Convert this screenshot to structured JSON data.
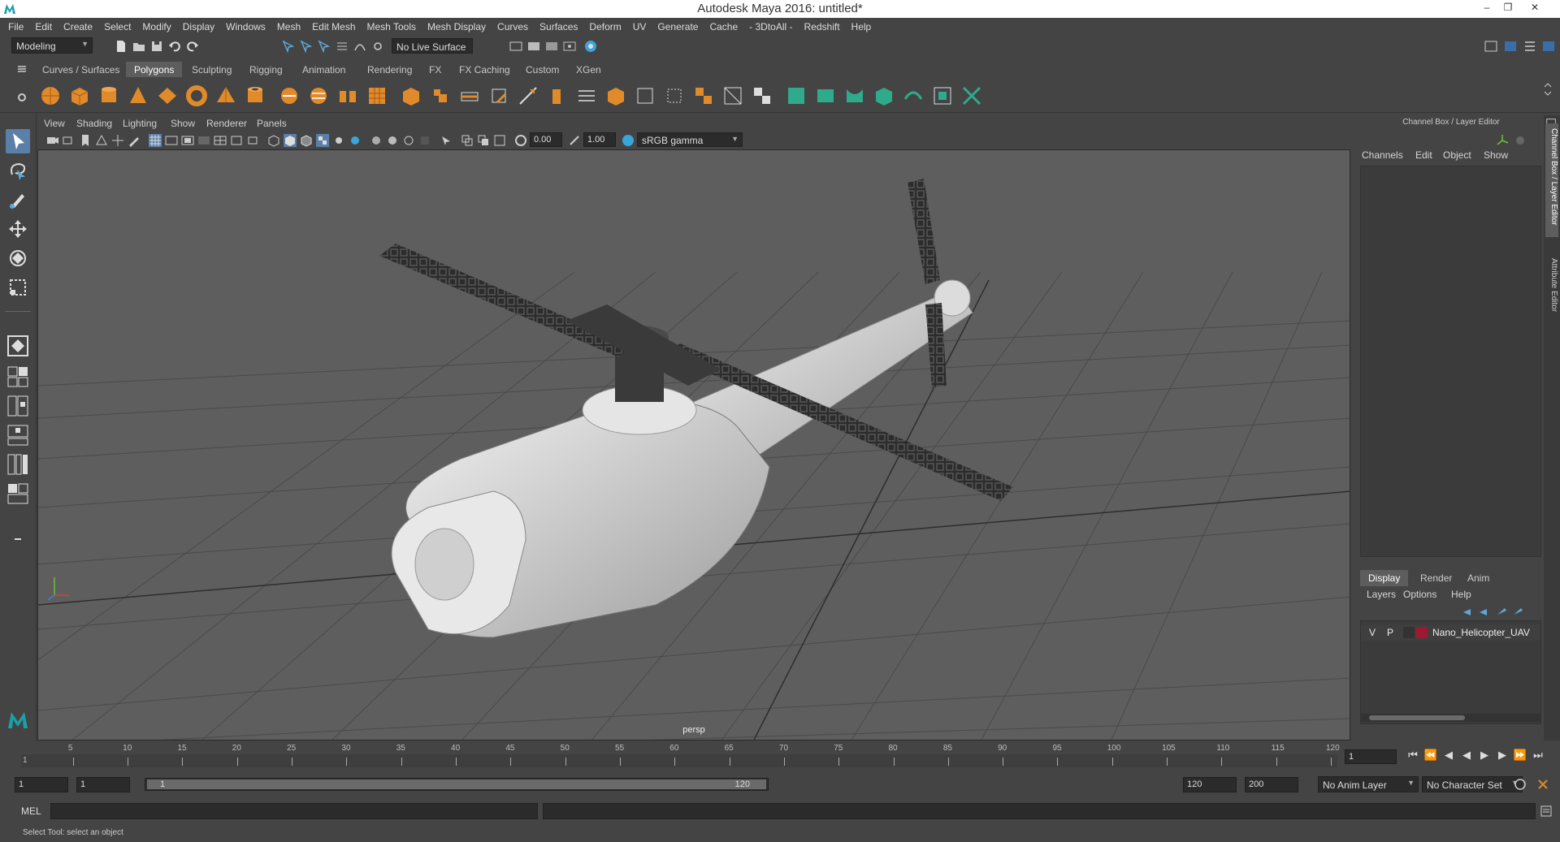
{
  "window": {
    "title": "Autodesk Maya 2016: untitled*",
    "minimize": "–",
    "restore": "❐",
    "close": "✕"
  },
  "menubar": [
    "File",
    "Edit",
    "Create",
    "Select",
    "Modify",
    "Display",
    "Windows",
    "Mesh",
    "Edit Mesh",
    "Mesh Tools",
    "Mesh Display",
    "Curves",
    "Surfaces",
    "Deform",
    "UV",
    "Generate",
    "Cache",
    "- 3DtoAll -",
    "Redshift",
    "Help"
  ],
  "statusline": {
    "menuset": "Modeling",
    "live_surface": "No Live Surface"
  },
  "shelf": {
    "tabs": [
      "Curves / Surfaces",
      "Polygons",
      "Sculpting",
      "Rigging",
      "Animation",
      "Rendering",
      "FX",
      "FX Caching",
      "Custom",
      "XGen"
    ],
    "active_tab": "Polygons"
  },
  "viewport": {
    "menus": [
      "View",
      "Shading",
      "Lighting",
      "Show",
      "Renderer",
      "Panels"
    ],
    "exposure": "0.00",
    "gamma": "1.00",
    "color_space": "sRGB gamma",
    "camera": "persp"
  },
  "channelbox": {
    "header": "Channel Box / Layer Editor",
    "menus": [
      "Channels",
      "Edit",
      "Object",
      "Show"
    ],
    "layer_tabs": [
      "Display",
      "Render",
      "Anim"
    ],
    "active_layer_tab": "Display",
    "layer_menus": [
      "Layers",
      "Options",
      "Help"
    ],
    "layer": {
      "visible": "V",
      "playback": "P",
      "name": "Nano_Helicopter_UAV",
      "color": "#a0182f"
    }
  },
  "side_tabs": [
    "Channel Box / Layer Editor",
    "Attribute Editor"
  ],
  "timeline": {
    "ticks": [
      "5",
      "10",
      "15",
      "20",
      "25",
      "30",
      "35",
      "40",
      "45",
      "50",
      "55",
      "60",
      "65",
      "70",
      "75",
      "80",
      "85",
      "90",
      "95",
      "100",
      "105",
      "110",
      "115",
      "120"
    ],
    "start_marker": "1",
    "current_frame": "1"
  },
  "range": {
    "start_frame": "1",
    "playback_start": "1",
    "range_start_label": "1",
    "range_end_label": "120",
    "playback_end": "120",
    "end_frame": "200",
    "anim_layer": "No Anim Layer",
    "character_set": "No Character Set"
  },
  "cmd": {
    "lang": "MEL"
  },
  "helpline": "Select Tool: select an object",
  "colors": {
    "viewport_bg": "#5e5e5e",
    "active_tool": "#5a7fa8",
    "shelf_orange": "#e08a2a",
    "shelf_teal": "#2faa8a"
  }
}
